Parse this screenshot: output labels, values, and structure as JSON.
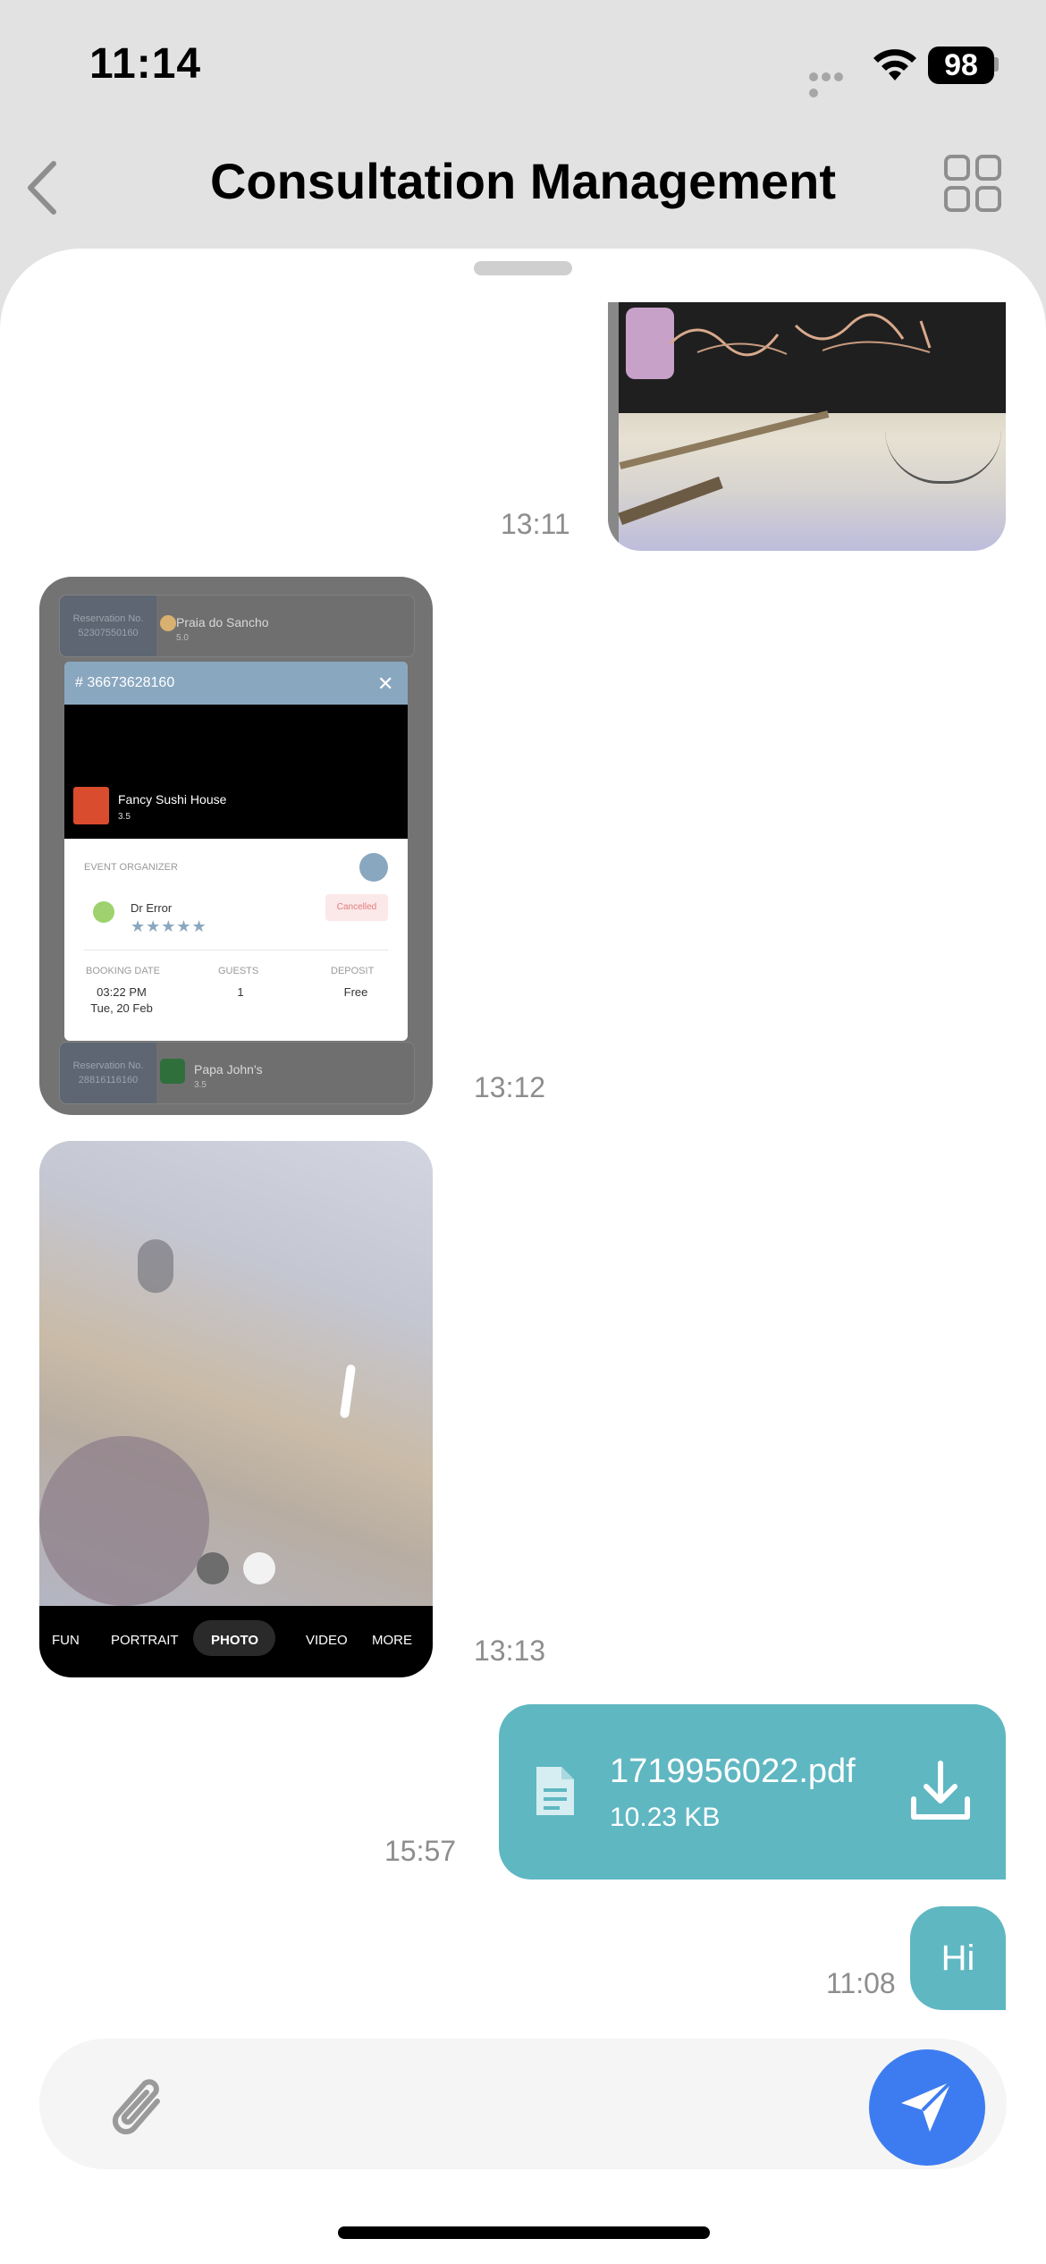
{
  "status_bar": {
    "time": "11:14",
    "battery": "98"
  },
  "header": {
    "title": "Consultation Management"
  },
  "messages": [
    {
      "type": "image",
      "time": "13:11"
    },
    {
      "type": "image",
      "time": "13:12",
      "screenshot": {
        "rows": [
          {
            "reservation_label": "Reservation No.",
            "reservation_no": "52307550160",
            "name": "Praia do Sancho",
            "rating": "5.0"
          },
          {
            "reservation_label": "Reservation No.",
            "reservation_no": "28816116160",
            "name": "Papa John's",
            "rating": "3.5"
          }
        ],
        "modal": {
          "id": "# 36673628160",
          "restaurant": "Fancy Sushi House",
          "rating": "3.5",
          "section_label": "EVENT ORGANIZER",
          "organizer": "Dr Error",
          "stars": "★★★★★",
          "status": "Cancelled",
          "booking_date_label": "BOOKING DATE",
          "booking_time": "03:22 PM",
          "booking_day": "Tue, 20 Feb",
          "guests_label": "GUESTS",
          "guests": "1",
          "deposit_label": "DEPOSIT",
          "deposit": "Free"
        }
      }
    },
    {
      "type": "image",
      "time": "13:13",
      "camera_modes": [
        "FUN",
        "PORTRAIT",
        "PHOTO",
        "VIDEO",
        "MORE"
      ]
    },
    {
      "type": "file",
      "time": "15:57",
      "file_name": "1719956022.pdf",
      "file_size": "10.23 KB"
    },
    {
      "type": "text",
      "time": "11:08",
      "text": "Hi"
    }
  ],
  "colors": {
    "bubble": "#5fb7c2",
    "send_button": "#3d7cf0"
  }
}
